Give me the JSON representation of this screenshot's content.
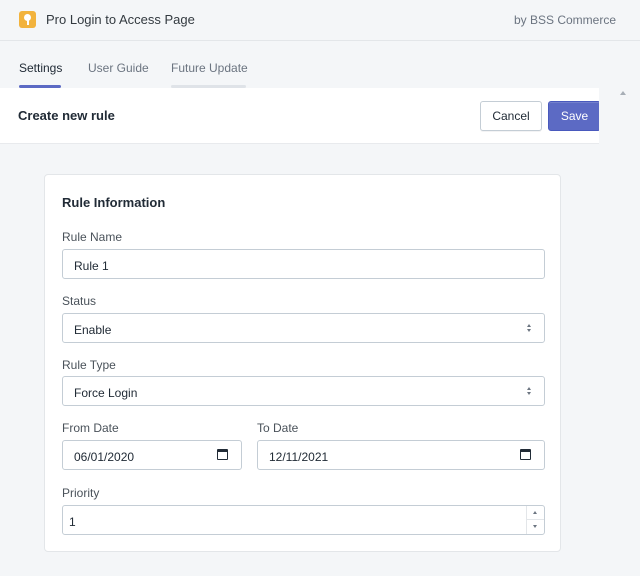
{
  "app": {
    "title": "Pro Login to Access Page",
    "vendor": "by BSS Commerce",
    "logo_icon": "keyhole-icon",
    "accent_color": "#5c6ac4",
    "logo_color": "#f2b33d"
  },
  "tabs": [
    {
      "label": "Settings",
      "active": true
    },
    {
      "label": "User Guide",
      "active": false
    },
    {
      "label": "Future Update",
      "active": false
    }
  ],
  "page": {
    "title": "Create new rule",
    "cancel_label": "Cancel",
    "save_label": "Save"
  },
  "form": {
    "section_title": "Rule Information",
    "rule_name": {
      "label": "Rule Name",
      "value": "Rule 1"
    },
    "status": {
      "label": "Status",
      "value": "Enable"
    },
    "rule_type": {
      "label": "Rule Type",
      "value": "Force Login"
    },
    "from_date": {
      "label": "From Date",
      "value": "06/01/2020"
    },
    "to_date": {
      "label": "To Date",
      "value": "12/11/2021"
    },
    "priority": {
      "label": "Priority",
      "value": "1"
    }
  }
}
